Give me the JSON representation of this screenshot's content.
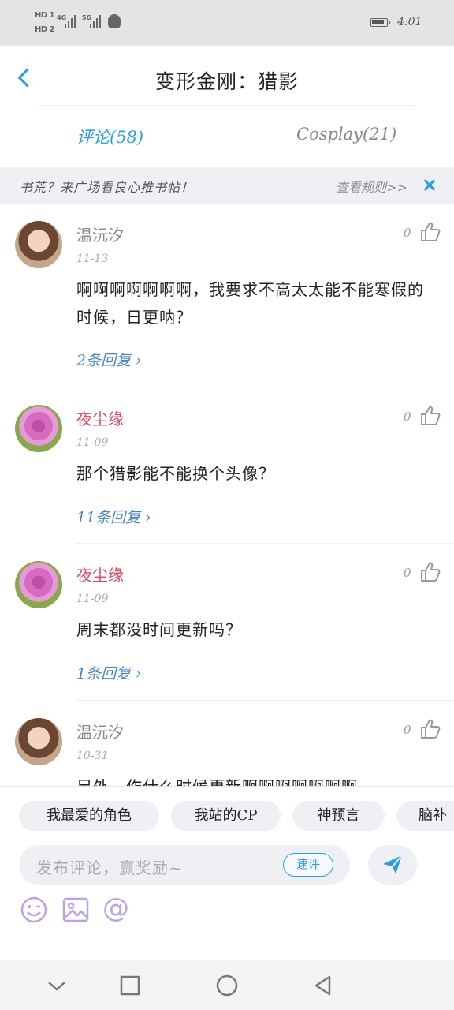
{
  "status_bar": {
    "hd_1": "HD 1",
    "hd_2": "HD 2",
    "net_1": "4G",
    "net_2": "5G",
    "time": "4:01"
  },
  "header": {
    "title": "变形金刚：猎影"
  },
  "tabs": [
    {
      "label": "评论(58)"
    },
    {
      "label": "Cosplay(21)"
    }
  ],
  "notice": {
    "text": "书荒？来广场看良心推书帖！",
    "rules_link": "查看规则>>"
  },
  "comments": [
    {
      "username": "温沅汐",
      "date": "11-13",
      "likes": "0",
      "content": "啊啊啊啊啊啊啊，我要求不高太太能不能寒假的时候，日更呐？",
      "reply": "2条回复 ›"
    },
    {
      "username": "夜尘缘",
      "date": "11-09",
      "likes": "0",
      "content": "那个猎影能不能换个头像？",
      "reply": "11条回复 ›"
    },
    {
      "username": "夜尘缘",
      "date": "11-09",
      "likes": "0",
      "content": "周末都没时间更新吗？",
      "reply": "1条回复 ›"
    },
    {
      "username": "温沅汐",
      "date": "10-31",
      "likes": "0",
      "content": "另外，作什么时候更新啊啊啊啊啊啊啊"
    }
  ],
  "bottom": {
    "tags": [
      "我最爱的角色",
      "我站的CP",
      "神预言",
      "脑补"
    ],
    "input_placeholder": "发布评论，赢奖励~",
    "quick_comment": "速评"
  },
  "colors": {
    "accent": "#2d9de0",
    "username_red": "#d9495e",
    "reply_link": "#4a86c4"
  }
}
